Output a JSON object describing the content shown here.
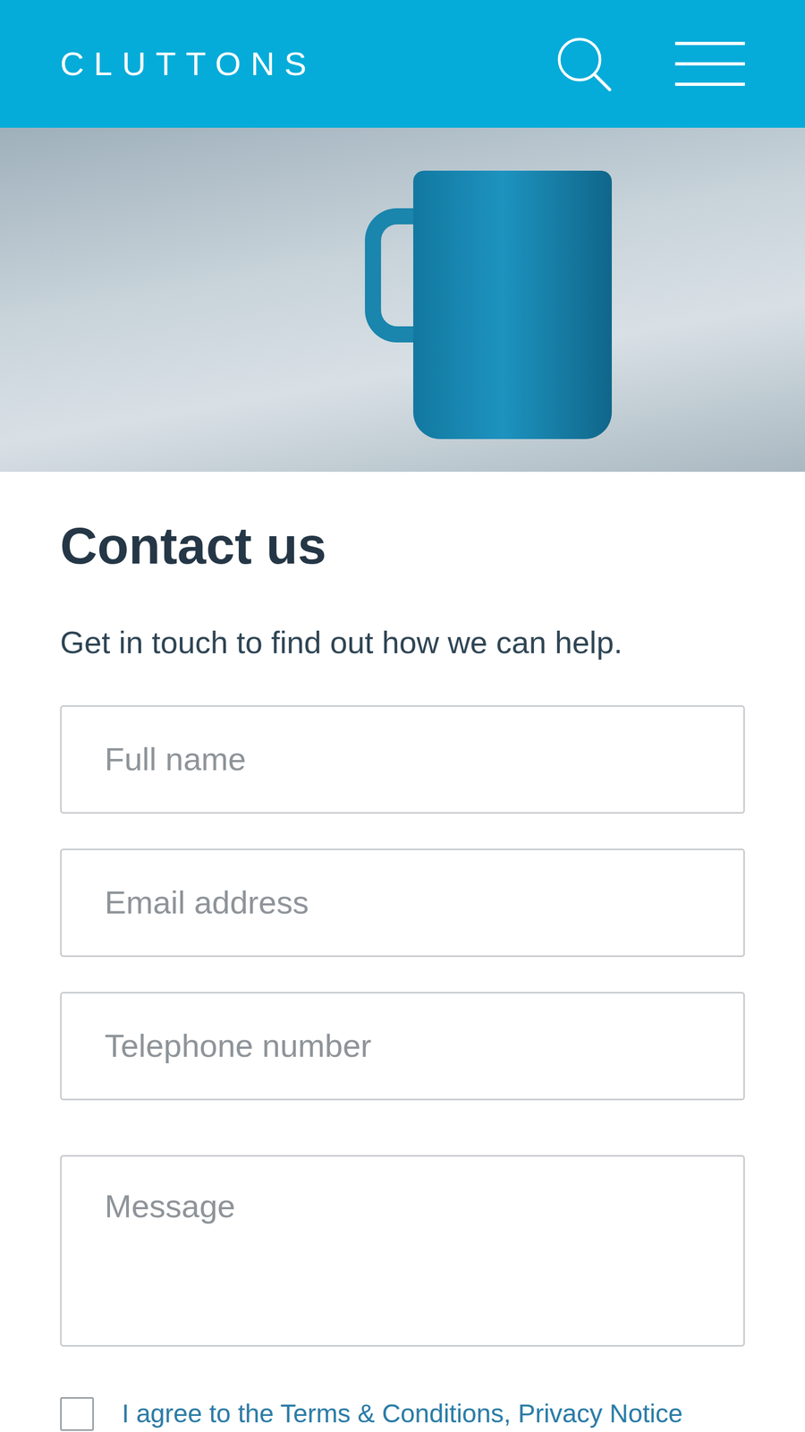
{
  "header": {
    "logo": "CLUTTONS"
  },
  "contact": {
    "title": "Contact us",
    "subtitle": "Get in touch to find out how we can help."
  },
  "form": {
    "fields": [
      {
        "placeholder": "Full name",
        "kind": "input"
      },
      {
        "placeholder": "Email address",
        "kind": "input"
      },
      {
        "placeholder": "Telephone number",
        "kind": "input"
      },
      {
        "placeholder": "Message",
        "kind": "textarea"
      }
    ],
    "consent": {
      "checked": false,
      "parts": [
        {
          "text": "I agree to the ",
          "kind": "text"
        },
        {
          "text": "Terms & Conditions",
          "kind": "link"
        },
        {
          "text": ", ",
          "kind": "text"
        },
        {
          "text": "Privacy Notice",
          "kind": "link"
        }
      ]
    }
  }
}
